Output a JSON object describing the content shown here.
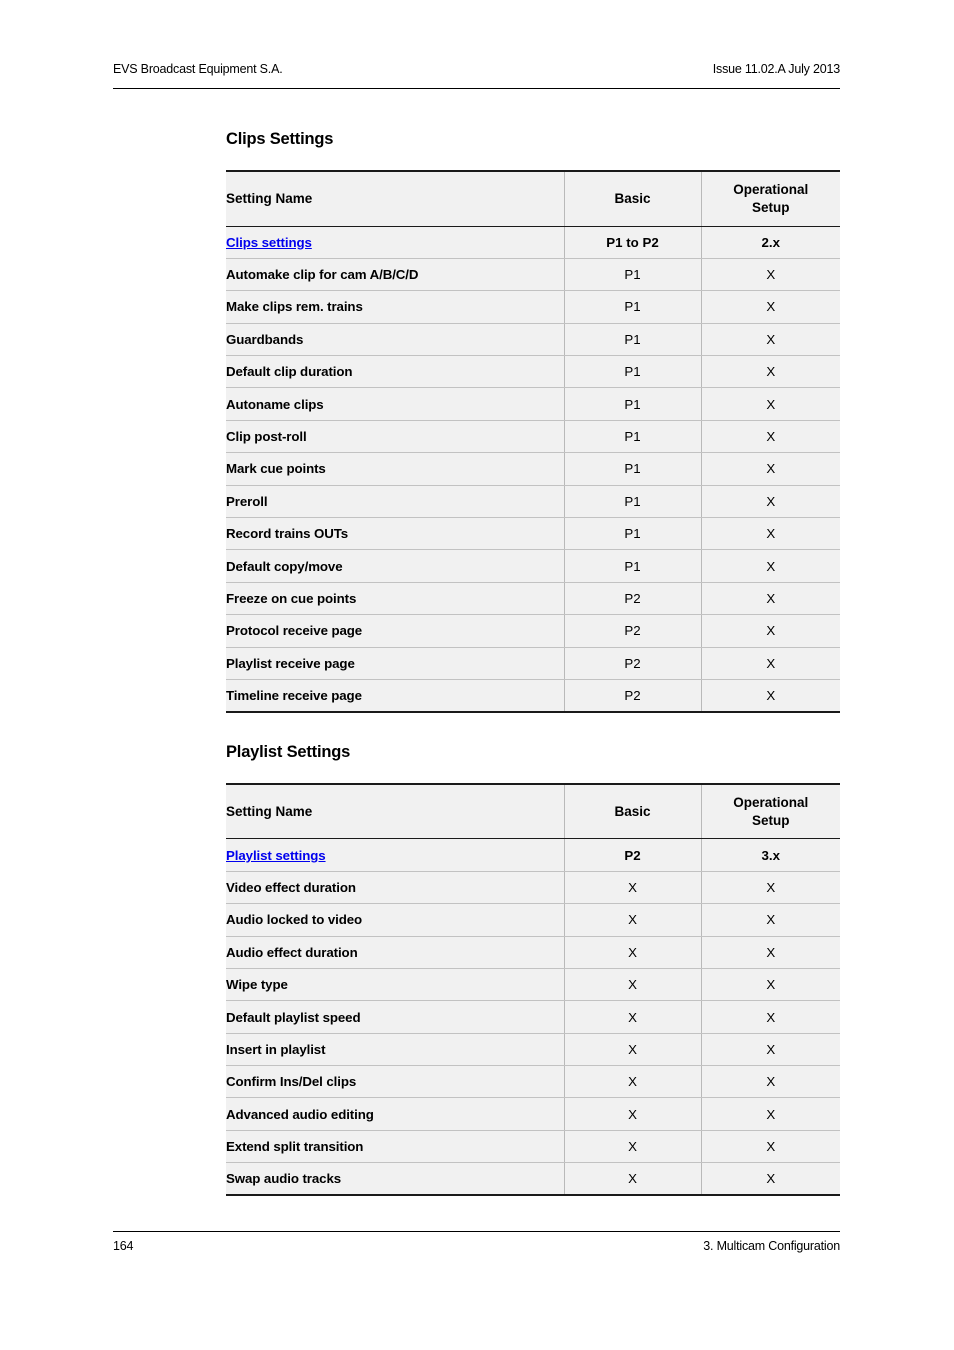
{
  "running_header": {
    "left": "EVS Broadcast Equipment S.A.",
    "right": "Issue 11.02.A  July 2013"
  },
  "running_footer": {
    "page_number": "164",
    "chapter": "3. Multicam Configuration"
  },
  "colors": {
    "link": "#0000ee",
    "cell_background": "#f1f1f1",
    "rule": "#000000",
    "cell_border": "#c2c2c2"
  },
  "sections": [
    {
      "title": "Clips Settings",
      "table": {
        "columns": [
          "Setting Name",
          "Basic",
          "Operational Setup"
        ],
        "column_labels": {
          "name": "Setting Name",
          "basic": "Basic",
          "setup_line1": "Operational",
          "setup_line2": "Setup"
        },
        "rows": [
          {
            "name": "Clips settings",
            "basic": "P1 to P2",
            "setup": "2.x",
            "is_link": true
          },
          {
            "name": "Automake clip for cam A/B/C/D",
            "basic": "P1",
            "setup": "X",
            "is_link": false
          },
          {
            "name": "Make clips rem. trains",
            "basic": "P1",
            "setup": "X",
            "is_link": false
          },
          {
            "name": "Guardbands",
            "basic": "P1",
            "setup": "X",
            "is_link": false
          },
          {
            "name": "Default clip duration",
            "basic": "P1",
            "setup": "X",
            "is_link": false
          },
          {
            "name": "Autoname clips",
            "basic": "P1",
            "setup": "X",
            "is_link": false
          },
          {
            "name": "Clip post-roll",
            "basic": "P1",
            "setup": "X",
            "is_link": false
          },
          {
            "name": "Mark cue points",
            "basic": "P1",
            "setup": "X",
            "is_link": false
          },
          {
            "name": "Preroll",
            "basic": "P1",
            "setup": "X",
            "is_link": false
          },
          {
            "name": "Record trains OUTs",
            "basic": "P1",
            "setup": "X",
            "is_link": false
          },
          {
            "name": "Default copy/move",
            "basic": "P1",
            "setup": "X",
            "is_link": false
          },
          {
            "name": "Freeze on cue points",
            "basic": "P2",
            "setup": "X",
            "is_link": false
          },
          {
            "name": "Protocol receive page",
            "basic": "P2",
            "setup": "X",
            "is_link": false
          },
          {
            "name": "Playlist receive page",
            "basic": "P2",
            "setup": "X",
            "is_link": false
          },
          {
            "name": "Timeline receive page",
            "basic": "P2",
            "setup": "X",
            "is_link": false
          }
        ]
      }
    },
    {
      "title": "Playlist Settings",
      "table": {
        "columns": [
          "Setting Name",
          "Basic",
          "Operational Setup"
        ],
        "column_labels": {
          "name": "Setting Name",
          "basic": "Basic",
          "setup_line1": "Operational",
          "setup_line2": "Setup"
        },
        "rows": [
          {
            "name": "Playlist settings",
            "basic": "P2",
            "setup": "3.x",
            "is_link": true
          },
          {
            "name": "Video effect duration",
            "basic": "X",
            "setup": "X",
            "is_link": false
          },
          {
            "name": "Audio locked to video",
            "basic": "X",
            "setup": "X",
            "is_link": false
          },
          {
            "name": "Audio effect duration",
            "basic": "X",
            "setup": "X",
            "is_link": false
          },
          {
            "name": "Wipe type",
            "basic": "X",
            "setup": "X",
            "is_link": false
          },
          {
            "name": "Default playlist speed",
            "basic": "X",
            "setup": "X",
            "is_link": false
          },
          {
            "name": "Insert in playlist",
            "basic": "X",
            "setup": "X",
            "is_link": false
          },
          {
            "name": "Confirm Ins/Del clips",
            "basic": "X",
            "setup": "X",
            "is_link": false
          },
          {
            "name": "Advanced audio editing",
            "basic": "X",
            "setup": "X",
            "is_link": false
          },
          {
            "name": "Extend split transition",
            "basic": "X",
            "setup": "X",
            "is_link": false
          },
          {
            "name": "Swap audio tracks",
            "basic": "X",
            "setup": "X",
            "is_link": false
          }
        ]
      }
    }
  ]
}
